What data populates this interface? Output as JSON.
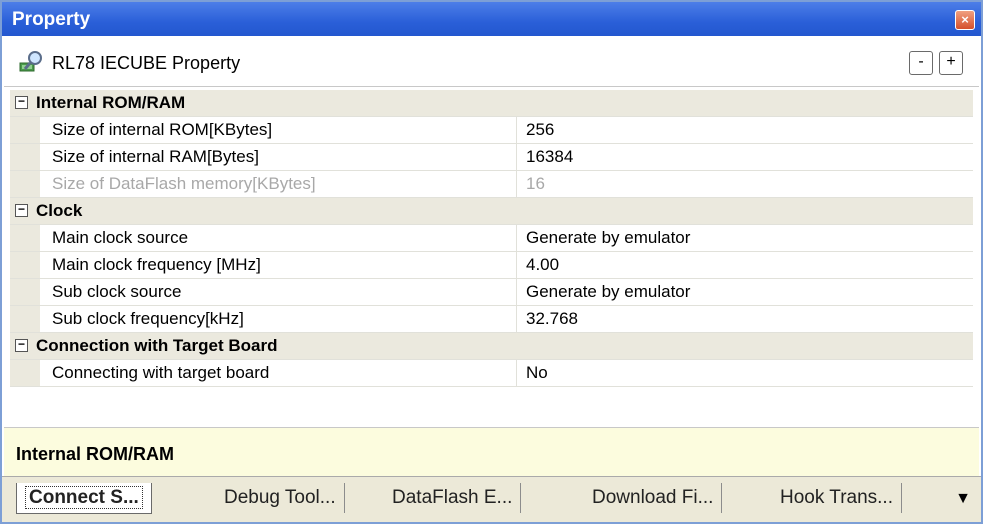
{
  "window": {
    "title": "Property",
    "close_glyph": "×"
  },
  "header": {
    "label": "RL78 IECUBE Property",
    "icon": "property-magnifier-icon",
    "minus_label": "-",
    "plus_label": "+"
  },
  "categories": [
    {
      "label": "Internal ROM/RAM",
      "toggle": "−",
      "items": [
        {
          "name": "Size of internal ROM[KBytes]",
          "value": "256"
        },
        {
          "name": "Size of internal RAM[Bytes]",
          "value": "16384"
        },
        {
          "name": "Size of DataFlash memory[KBytes]",
          "value": "16"
        }
      ]
    },
    {
      "label": "Clock",
      "toggle": "−",
      "items": [
        {
          "name": "Main clock source",
          "value": "Generate by emulator"
        },
        {
          "name": "Main clock frequency [MHz]",
          "value": "4.00"
        },
        {
          "name": "Sub clock source",
          "value": "Generate by emulator"
        },
        {
          "name": "Sub clock frequency[kHz]",
          "value": "32.768"
        }
      ]
    },
    {
      "label": "Connection with Target Board",
      "toggle": "−",
      "items": [
        {
          "name": "Connecting with target board",
          "value": "No"
        }
      ]
    }
  ],
  "description": {
    "title": "Internal ROM/RAM"
  },
  "tabs": [
    {
      "label": "Connect S..."
    },
    {
      "label": "Debug Tool..."
    },
    {
      "label": "DataFlash E..."
    },
    {
      "label": "Download Fi..."
    },
    {
      "label": "Hook Trans..."
    }
  ],
  "tab_menu_glyph": "▼",
  "colors": {
    "title_bar": "#2a5fd8",
    "category_bg": "#ebe9de",
    "description_bg": "#fcfcde",
    "disabled_text": "#a8a8a8"
  }
}
